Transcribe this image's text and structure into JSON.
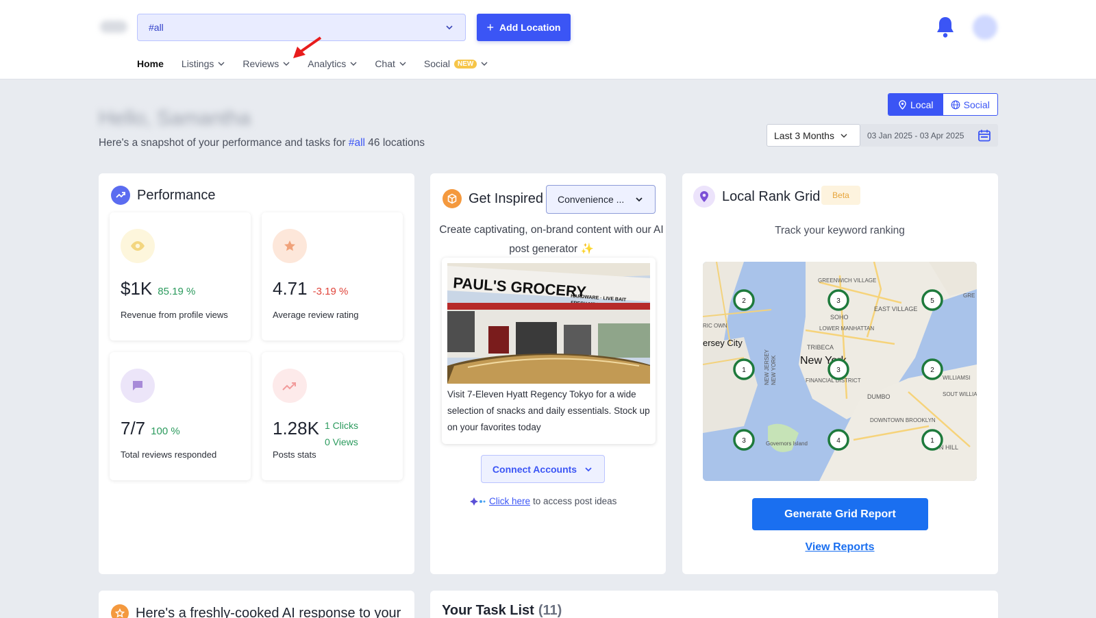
{
  "header": {
    "location_select_value": "#all",
    "add_location_label": "Add Location",
    "nav": [
      {
        "label": "Home"
      },
      {
        "label": "Listings"
      },
      {
        "label": "Reviews"
      },
      {
        "label": "Analytics"
      },
      {
        "label": "Chat"
      },
      {
        "label": "Social",
        "badge": "NEW"
      }
    ]
  },
  "greeting": {
    "name_blurred": "Hello, Samantha",
    "subtitle_prefix": "Here's a snapshot of your performance and tasks for",
    "subtitle_hash": "#all",
    "subtitle_suffix": "46 locations"
  },
  "view_toggle": {
    "local": "Local",
    "social": "Social"
  },
  "date_range": {
    "preset": "Last 3 Months",
    "range": "03 Jan 2025 - 03 Apr 2025"
  },
  "performance": {
    "title": "Performance",
    "stats": [
      {
        "value": "$1K",
        "change": "85.19 %",
        "label": "Revenue from profile views"
      },
      {
        "value": "4.71",
        "change": "-3.19 %",
        "label": "Average review rating"
      },
      {
        "value": "7/7",
        "change": "100 %",
        "label": "Total reviews responded"
      },
      {
        "value": "1.28K",
        "clicks": "1 Clicks",
        "views": "0 Views",
        "label": "Posts stats"
      }
    ]
  },
  "inspire": {
    "title": "Get Inspired",
    "category_select": "Convenience ...",
    "description": "Create captivating, on-brand content with our AI post generator ✨",
    "post_text": "Visit 7-Eleven Hyatt Regency Tokyo for a wide selection of snacks and daily essentials. Stock up on your favorites today",
    "store_sign_main": "PAUL'S GROCERY",
    "store_sign_sub": "HARDWARE · LIVE BAIT",
    "store_sign_sub2": "FRESH MEATS · GRILL",
    "connect_label": "Connect Accounts",
    "click_here": "Click here ",
    "click_suffix": "to access post ideas"
  },
  "rank_grid": {
    "title": "Local Rank Grid",
    "badge": "Beta",
    "subtitle": "Track your keyword ranking",
    "map_labels": {
      "greenwich": "GREENWICH VILLAGE",
      "east_village": "EAST VILLAGE",
      "soho": "SOHO",
      "lower_manhattan": "LOWER MANHATTAN",
      "jersey_city": "ersey City",
      "tribeca": "TRIBECA",
      "new_york": "New York",
      "financial": "FINANCIAL DISTRICT",
      "dumbo": "DUMBO",
      "downtown_brooklyn": "DOWNTOWN BROOKLYN",
      "governors": "Governors Island",
      "williamsburg": "WILLIAMSI",
      "south_williams": "SOUT WILLIAMS",
      "new_jersey": "NEW JERSEY",
      "new_york_state": "NEW YORK",
      "ric_own": "RIC OWN",
      "gre": "GRE",
      "on_hill": "ON HILL"
    },
    "pins": [
      "2",
      "3",
      "5",
      "1",
      "3",
      "2",
      "3",
      "4",
      "1"
    ],
    "generate_label": "Generate Grid Report",
    "view_reports": "View Reports"
  },
  "bottom": {
    "ai_response_title": "Here's a freshly-cooked AI response to your",
    "task_title": "Your Task List",
    "task_count": "(11)"
  },
  "colors": {
    "primary": "#3b55f5",
    "positive": "#2b9a5d",
    "negative": "#e0443a",
    "pin_green": "#1e7a3c"
  }
}
